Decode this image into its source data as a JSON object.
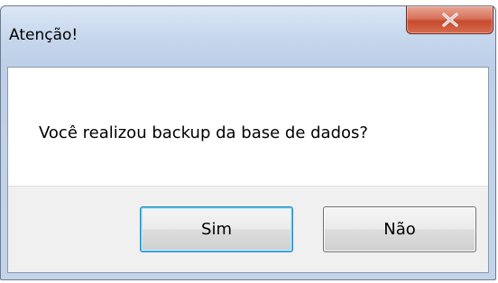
{
  "dialog": {
    "title": "Atenção!",
    "message": "Você realizou backup da base de dados?",
    "buttons": {
      "yes_label": "Sim",
      "no_label": "Não"
    },
    "close_icon": "close-x-icon"
  },
  "colors": {
    "close_button": "#c64a2f",
    "frame": "#c3d4ea",
    "button_area": "#f0f0f0"
  }
}
